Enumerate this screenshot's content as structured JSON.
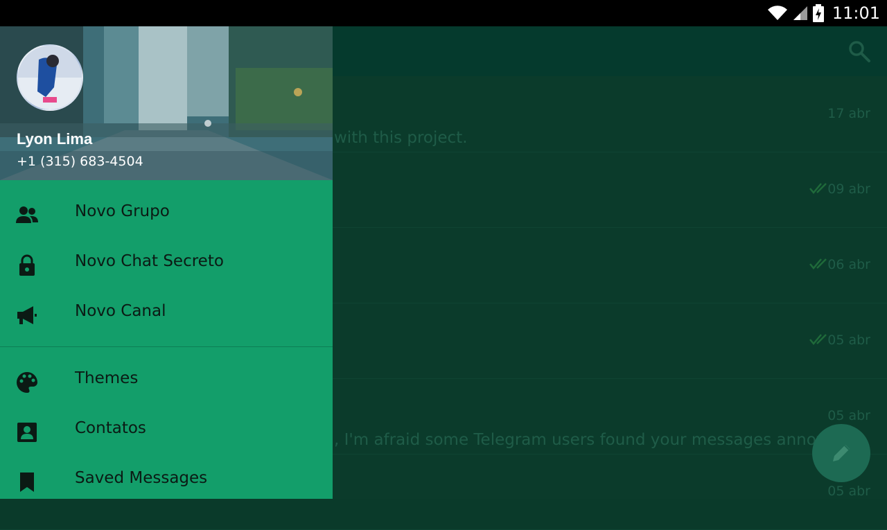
{
  "status_bar": {
    "time": "11:01"
  },
  "drawer": {
    "user_name": "Lyon Lima",
    "user_phone": "+1 (315) 683-4504",
    "menu": [
      {
        "label": "Novo Grupo",
        "icon": "group-icon"
      },
      {
        "label": "Novo Chat Secreto",
        "icon": "lock-icon"
      },
      {
        "label": "Novo Canal",
        "icon": "megaphone-icon"
      },
      {
        "label": "Themes",
        "icon": "palette-icon"
      },
      {
        "label": "Contatos",
        "icon": "contacts-icon"
      },
      {
        "label": "Saved Messages",
        "icon": "bookmark-icon"
      }
    ]
  },
  "chats": [
    {
      "date": "17 abr",
      "preview": "with this project.",
      "read": false
    },
    {
      "date": "09 abr",
      "preview": "",
      "read": true
    },
    {
      "date": "06 abr",
      "preview": "",
      "read": true
    },
    {
      "date": "05 abr",
      "preview": "",
      "read": true
    },
    {
      "date": "05 abr",
      "preview": ", I'm afraid some Telegram users found your messages annoying",
      "read": false
    },
    {
      "date": "05 abr",
      "preview": "",
      "read": false
    }
  ],
  "colors": {
    "drawer_bg": "#139e6a",
    "toolbar_bg": "#053a2d",
    "chatlist_bg": "#0b3b2b",
    "fab_bg": "#1d6a53"
  }
}
